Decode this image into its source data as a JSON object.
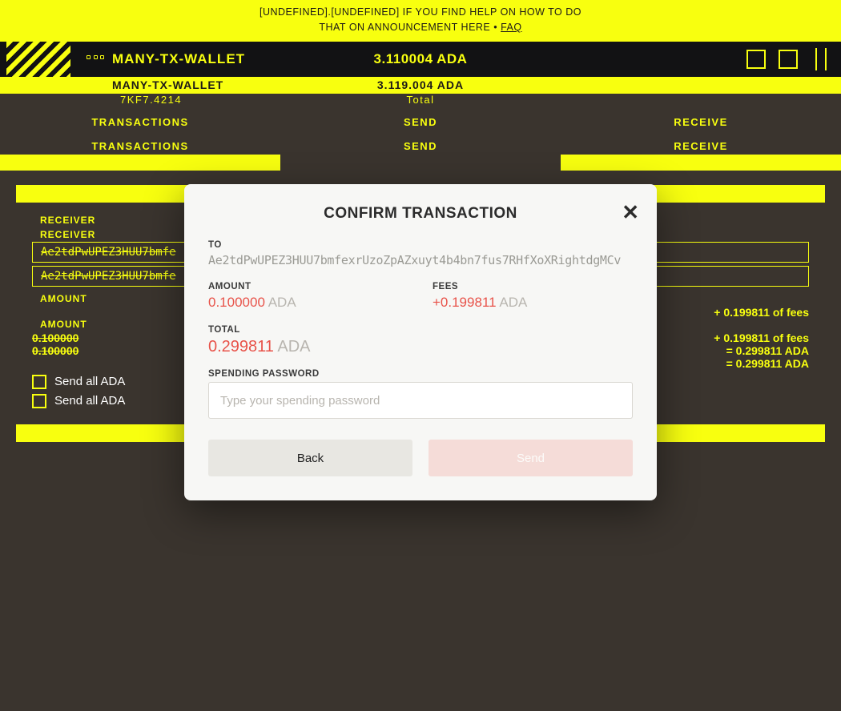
{
  "banner": {
    "line1": "[UNDEFINED].[UNDEFINED] IF YOU FIND HELP ON HOW TO DO",
    "line2": "THAT ON ANNOUNCEMENT HERE •",
    "line2_link": "FAQ"
  },
  "wallet": {
    "name": "MANY-TX-WALLET",
    "balance": "3.110004 ADA",
    "ticker_line": "7KF7.4214",
    "balance_sub": "3.119.004 ADA",
    "total_label": "Total"
  },
  "tabs": {
    "transactions": "TRANSACTIONS",
    "send": "SEND",
    "receive": "RECEIVE"
  },
  "send_form": {
    "receiver_label": "RECEIVER",
    "receiver_value": "Ae2tdPwUPEZ3HUU7bmfe",
    "amount_label": "AMOUNT",
    "amount_value": "0.100000",
    "fee_note": "+ 0.199811 of fees",
    "total_line": "= 0.299811 ADA",
    "send_all": "Send all ADA"
  },
  "modal": {
    "title": "CONFIRM TRANSACTION",
    "to_label": "TO",
    "to_value": "Ae2tdPwUPEZ3HUU7bmfexrUzoZpAZxuyt4b4bn7fus7RHfXoXRightdgMCv",
    "amount_label": "AMOUNT",
    "amount_value": "0.100000",
    "fees_label": "FEES",
    "fees_value": "+0.199811",
    "total_label": "TOTAL",
    "total_value": "0.299811",
    "currency": "ADA",
    "pw_label": "SPENDING PASSWORD",
    "pw_placeholder": "Type your spending password",
    "back": "Back",
    "send": "Send"
  }
}
